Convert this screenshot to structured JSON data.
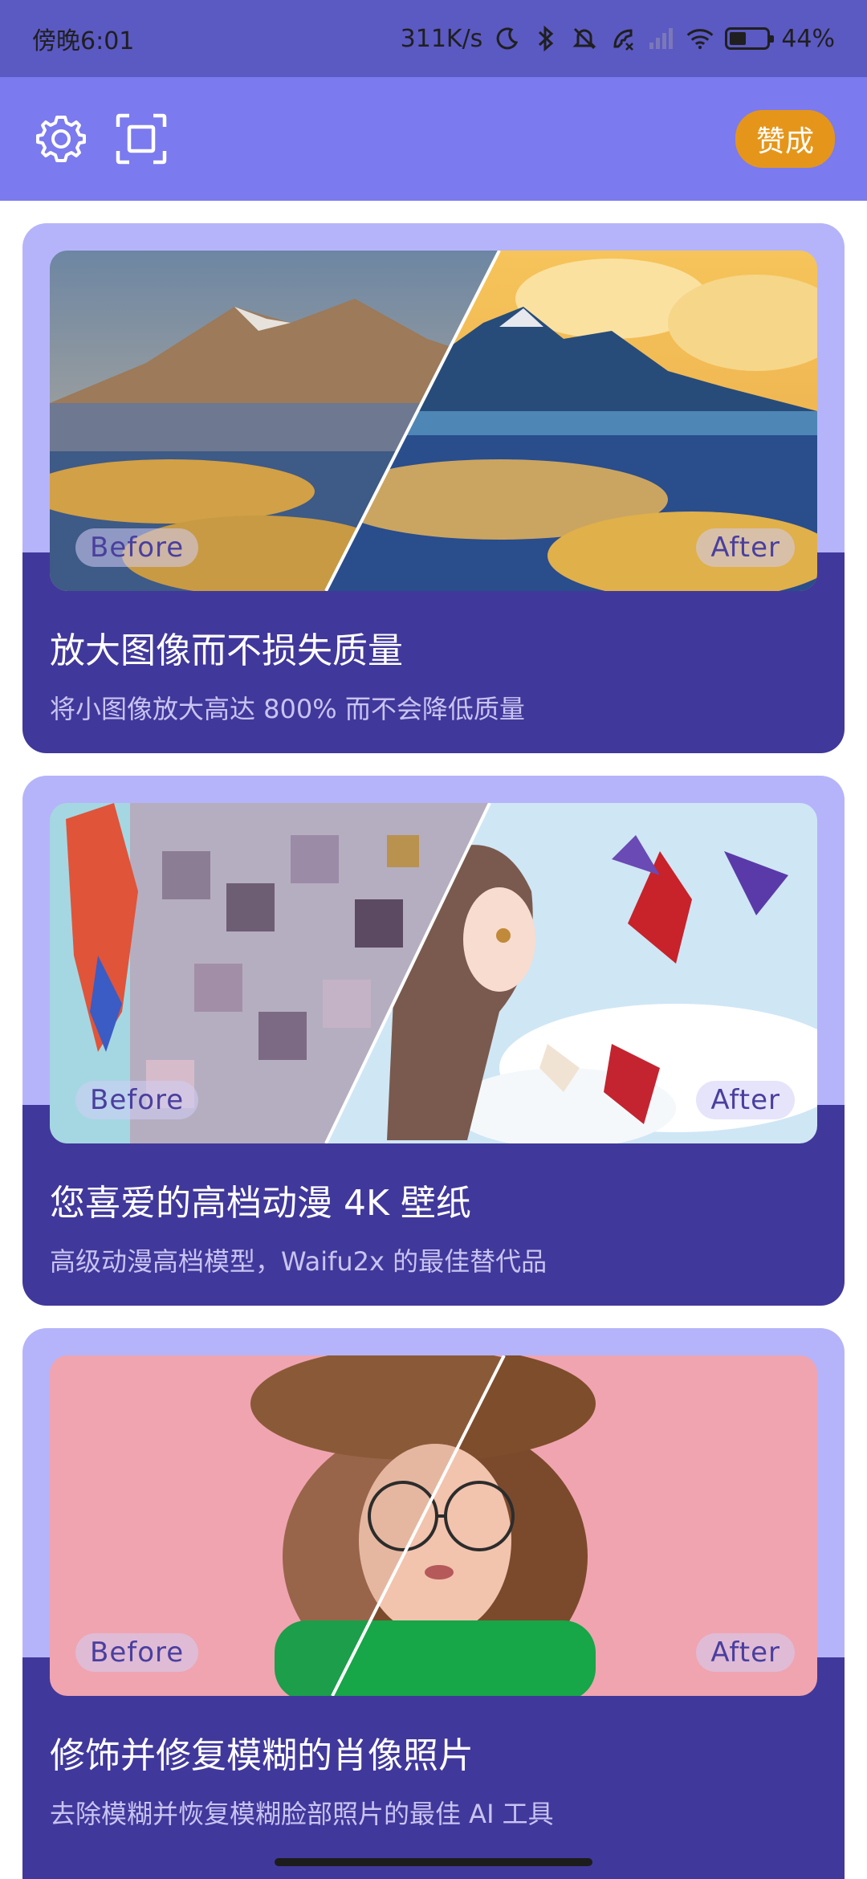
{
  "status_bar": {
    "time": "傍晚6:01",
    "network_speed": "311K/s",
    "battery_percent": "44%",
    "battery_level": 0.44,
    "icons": [
      "moon-icon",
      "bluetooth-icon",
      "mute-bell-icon",
      "call-icon",
      "signal-icon",
      "wifi-icon",
      "battery-icon"
    ]
  },
  "toolbar": {
    "icons": [
      "gear-icon",
      "scan-frame-icon"
    ],
    "donate_label": "赞成",
    "accent": "#7b7aee",
    "donate_color": "#e5961a"
  },
  "cards": [
    {
      "before_label": "Before",
      "after_label": "After",
      "title": "放大图像而不损失质量",
      "subtitle": "将小图像放大高达 800% 而不会降低质量"
    },
    {
      "before_label": "Before",
      "after_label": "After",
      "title": "您喜爱的高档动漫 4K 壁纸",
      "subtitle": "高级动漫高档模型，Waifu2x 的最佳替代品"
    },
    {
      "before_label": "Before",
      "after_label": "After",
      "title": "修饰并修复模糊的肖像照片",
      "subtitle": "去除模糊并恢复模糊脸部照片的最佳 AI 工具"
    }
  ],
  "colors": {
    "card_top": "#b5b4fa",
    "card_bottom": "#41389b",
    "status_bar": "#5b59c2"
  }
}
